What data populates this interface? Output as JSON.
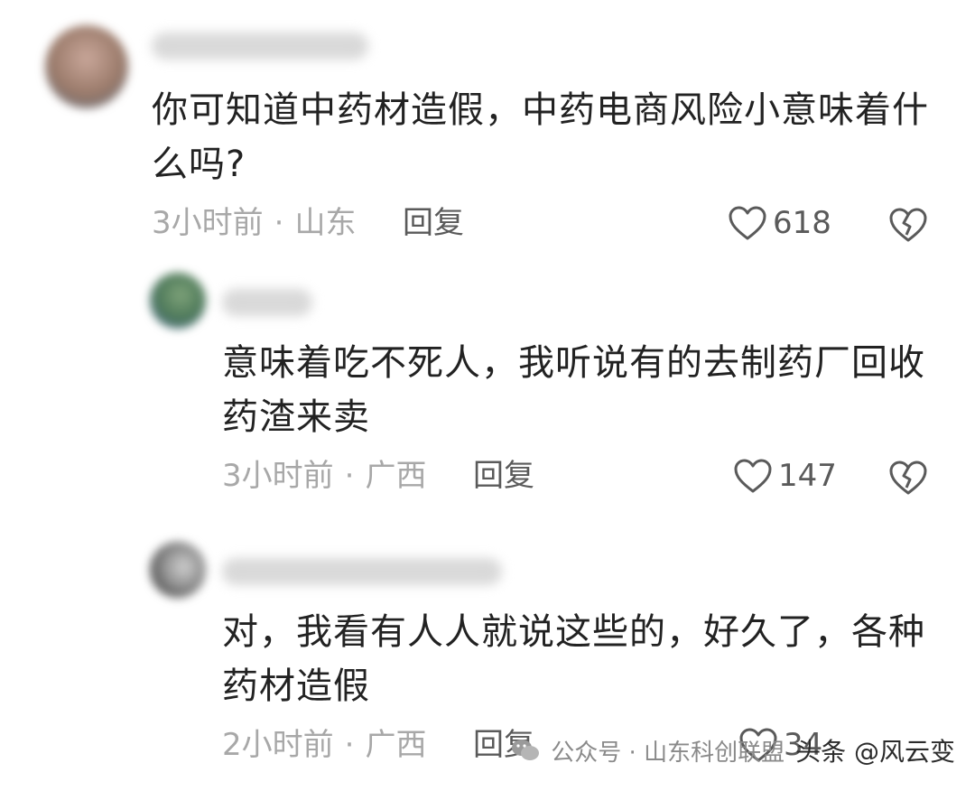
{
  "comments": [
    {
      "text_line1": "你可知道中药材造假，中药电商风险小意味着什",
      "text_line2": "么吗?",
      "time": "3小时前",
      "location": "山东",
      "reply_label": "回复",
      "likes": "618"
    },
    {
      "text_line1": "意味着吃不死人，我听说有的去制药厂回收",
      "text_line2": "药渣来卖",
      "time": "3小时前",
      "location": "广西",
      "reply_label": "回复",
      "likes": "147"
    },
    {
      "text_line1": "对，我看有人人就说这些的，好久了，各种",
      "text_line2": "药材造假",
      "time": "2小时前",
      "location": "广西",
      "reply_label": "回复",
      "likes": "34"
    }
  ],
  "separator": "·",
  "watermark": {
    "channel": "公众号 · 山东科创联盟",
    "source": "头条 @风云变"
  },
  "colors": {
    "meta": "#a8a8a8",
    "action": "#5a5a5a",
    "text": "#222222"
  }
}
